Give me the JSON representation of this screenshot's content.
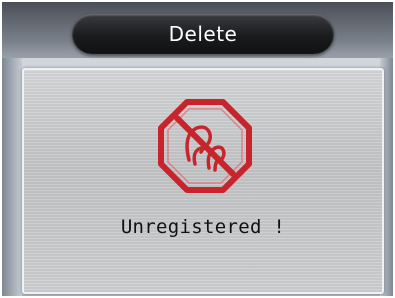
{
  "header": {
    "title": "Delete"
  },
  "dialog": {
    "icon": "unregistered-fingerprint-prohibited-icon",
    "message": "Unregistered !"
  },
  "colors": {
    "icon_red": "#c8242b",
    "title_pill": "#1a1b1d",
    "panel": "#c9cacc"
  }
}
